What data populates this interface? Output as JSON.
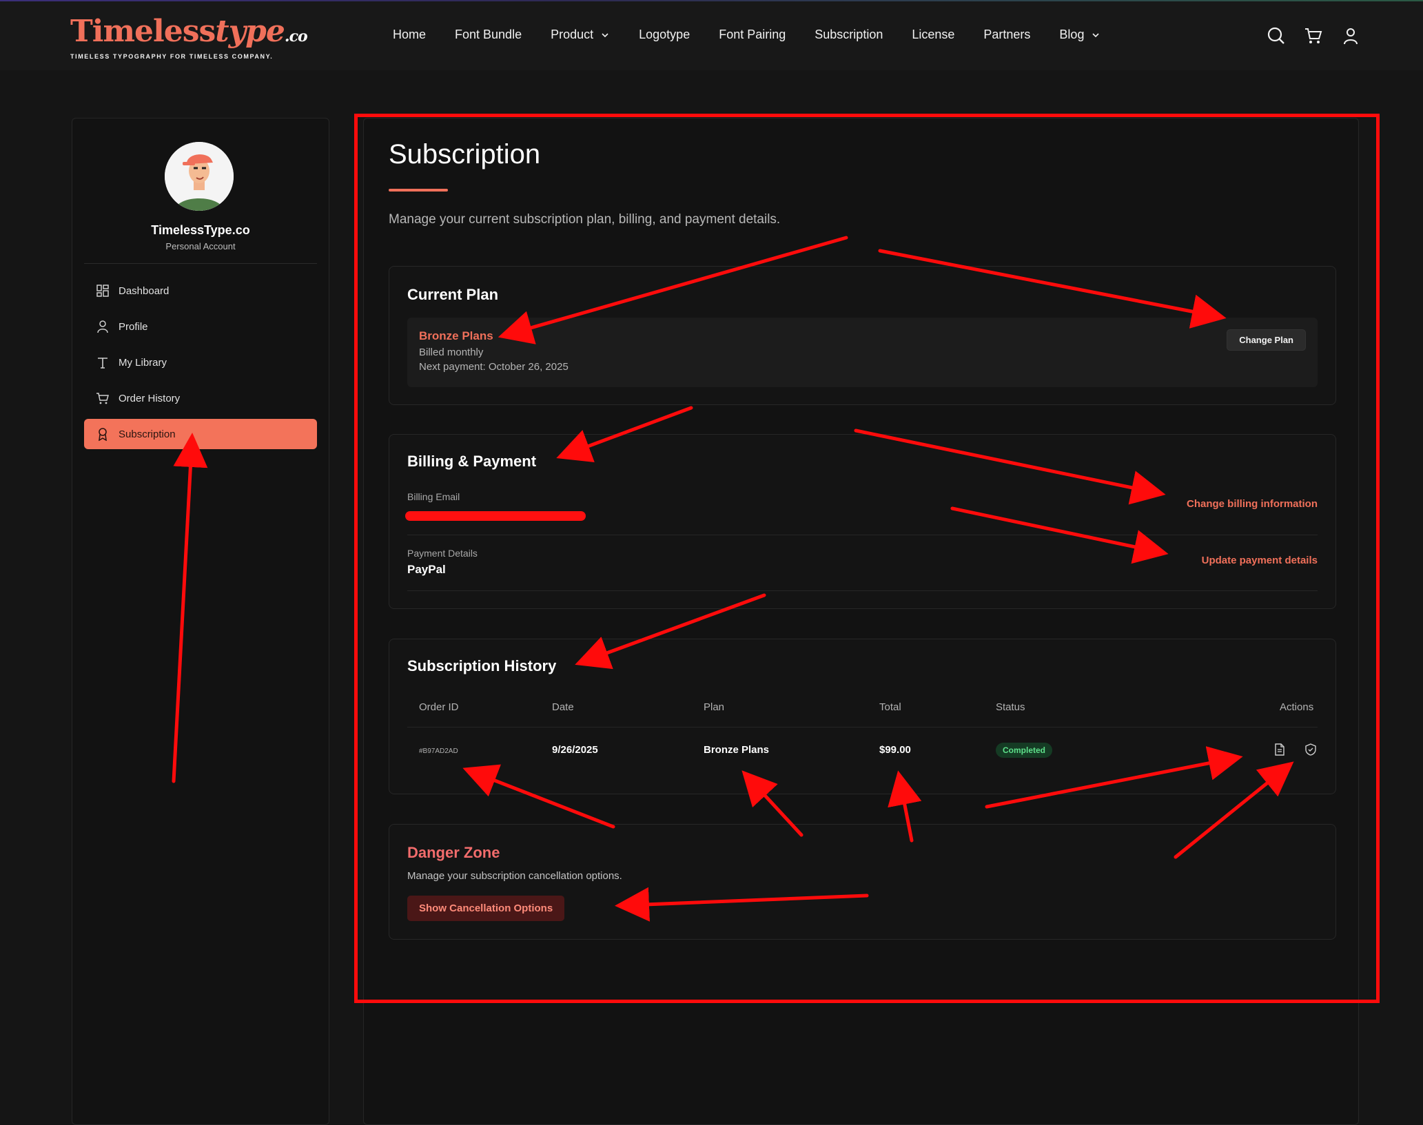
{
  "brand": {
    "logo_main": "Timeless",
    "logo_type": "type",
    "logo_suffix": ".co",
    "tagline": "TIMELESS TYPOGRAPHY FOR TIMELESS COMPANY.",
    "accent": "#f0705a"
  },
  "nav": {
    "items": [
      {
        "label": "Home"
      },
      {
        "label": "Font Bundle"
      },
      {
        "label": "Product",
        "has_dropdown": true
      },
      {
        "label": "Logotype"
      },
      {
        "label": "Font Pairing"
      },
      {
        "label": "Subscription"
      },
      {
        "label": "License"
      },
      {
        "label": "Partners"
      },
      {
        "label": "Blog",
        "has_dropdown": true
      }
    ],
    "icons": [
      "search-icon",
      "cart-icon",
      "user-icon"
    ]
  },
  "sidebar": {
    "account_name": "TimelessType.co",
    "account_type": "Personal Account",
    "items": [
      {
        "label": "Dashboard",
        "icon": "dashboard-icon"
      },
      {
        "label": "Profile",
        "icon": "user-icon"
      },
      {
        "label": "My Library",
        "icon": "type-icon"
      },
      {
        "label": "Order History",
        "icon": "cart-icon"
      },
      {
        "label": "Subscription",
        "icon": "badge-icon",
        "active": true
      }
    ]
  },
  "main": {
    "title": "Subscription",
    "subtitle": "Manage your current subscription plan, billing, and payment details.",
    "current_plan": {
      "title": "Current Plan",
      "plan_name": "Bronze Plans",
      "billed": "Billed monthly",
      "next_payment": "Next payment: October 26, 2025",
      "change_label": "Change Plan"
    },
    "billing": {
      "title": "Billing & Payment",
      "email_label": "Billing Email",
      "change_billing_label": "Change billing information",
      "payment_label": "Payment Details",
      "payment_value": "PayPal",
      "update_payment_label": "Update payment details"
    },
    "history": {
      "title": "Subscription History",
      "columns": [
        "Order ID",
        "Date",
        "Plan",
        "Total",
        "Status",
        "Actions"
      ],
      "rows": [
        {
          "order_id": "#B97AD2AD",
          "date": "9/26/2025",
          "plan": "Bronze Plans",
          "total": "$99.00",
          "status": "Completed"
        }
      ]
    },
    "danger": {
      "title": "Danger Zone",
      "subtitle": "Manage your subscription cancellation options.",
      "button_label": "Show Cancellation Options"
    }
  },
  "annotation": {
    "highlight_color": "#ff0b0b"
  }
}
